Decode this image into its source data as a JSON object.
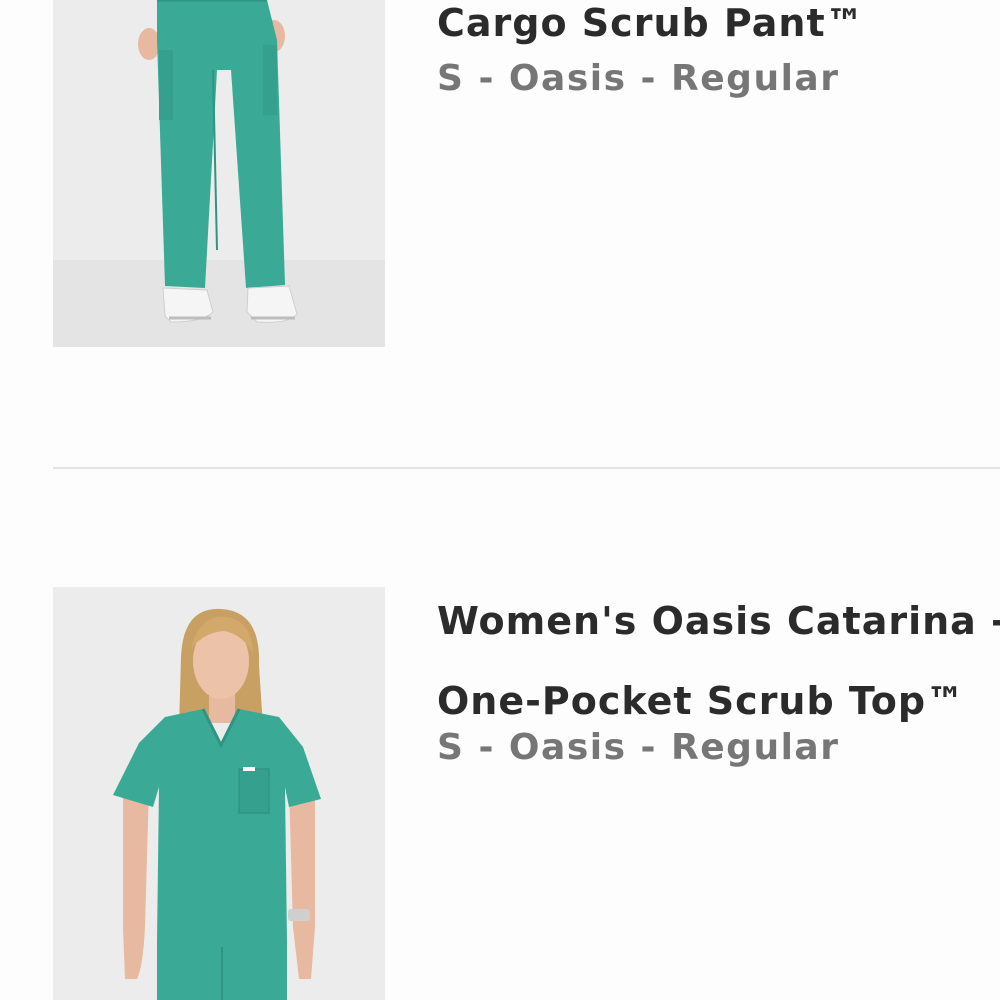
{
  "cart": {
    "items": [
      {
        "title_lines": [
          "Cargo Scrub Pant™"
        ],
        "variant": "S - Oasis - Regular",
        "image": "pants-product-photo"
      },
      {
        "title_lines": [
          "Women's Oasis Catarina -",
          "One-Pocket Scrub Top™"
        ],
        "variant": "S - Oasis - Regular",
        "image": "scrub-top-product-photo"
      }
    ]
  },
  "colors": {
    "scrub": "#3aaa97",
    "photo_background": "#ececec",
    "title_text": "#2b2b2b",
    "variant_text": "#767676"
  }
}
